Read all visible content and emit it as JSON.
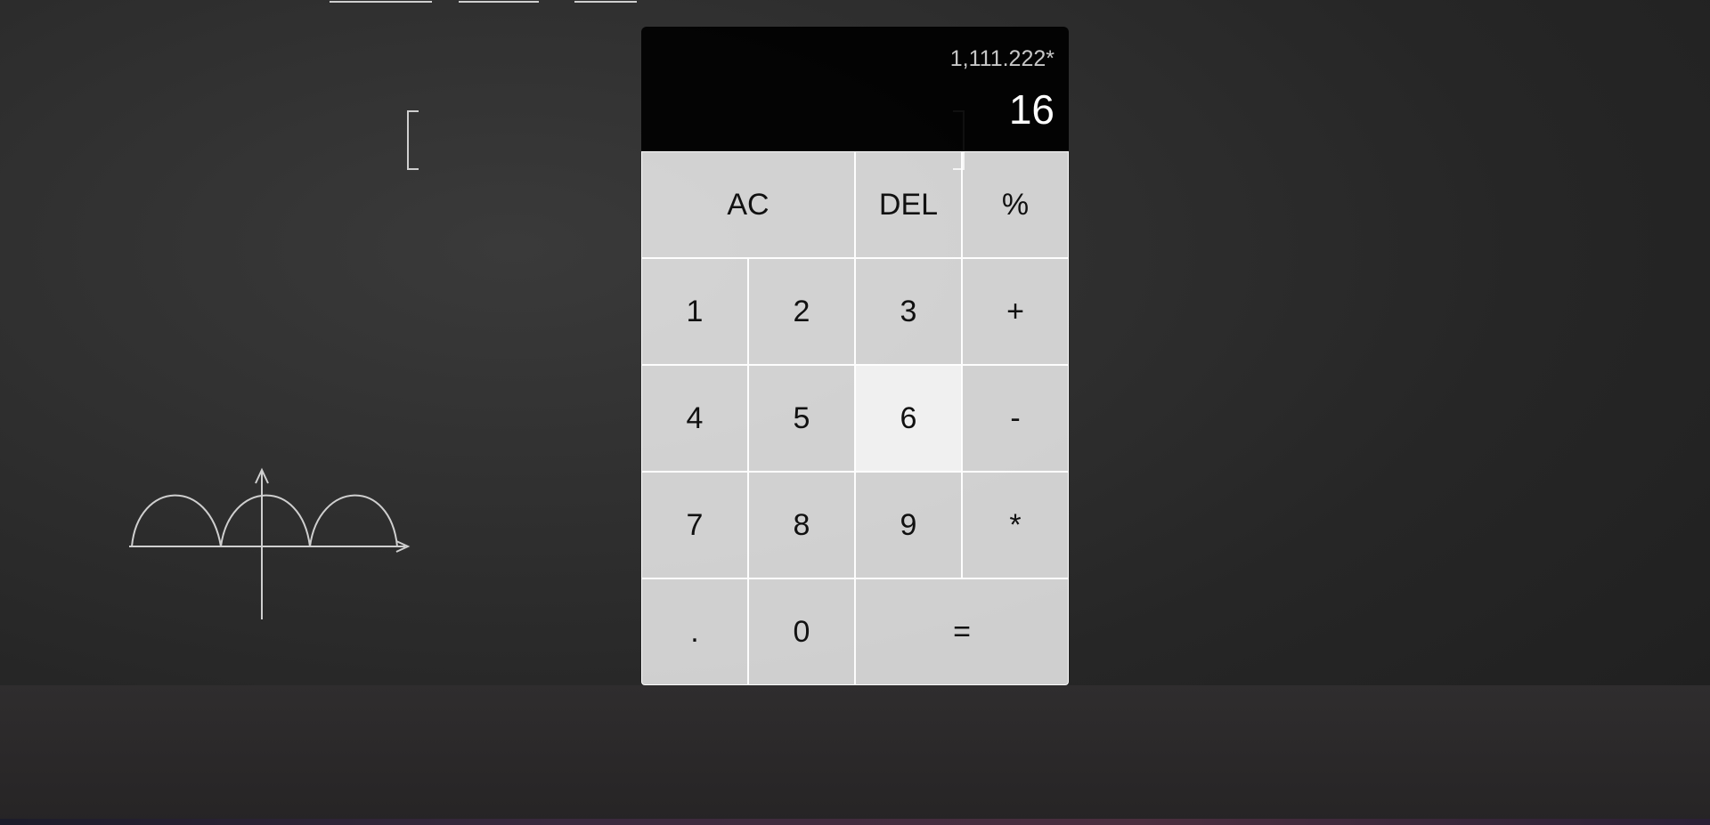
{
  "display": {
    "previous_operand": "1,111.222*",
    "current_operand": "16"
  },
  "keys": {
    "ac": "AC",
    "del": "DEL",
    "percent": "%",
    "one": "1",
    "two": "2",
    "three": "3",
    "plus": "+",
    "four": "4",
    "five": "5",
    "six": "6",
    "minus": "-",
    "seven": "7",
    "eight": "8",
    "nine": "9",
    "multiply": "*",
    "decimal": ".",
    "zero": "0",
    "equals": "="
  },
  "colors": {
    "display_bg": "#0a0a0a",
    "key_bg": "#cccccc",
    "key_hover_bg": "#ededed",
    "board": "#2b2b2b"
  }
}
